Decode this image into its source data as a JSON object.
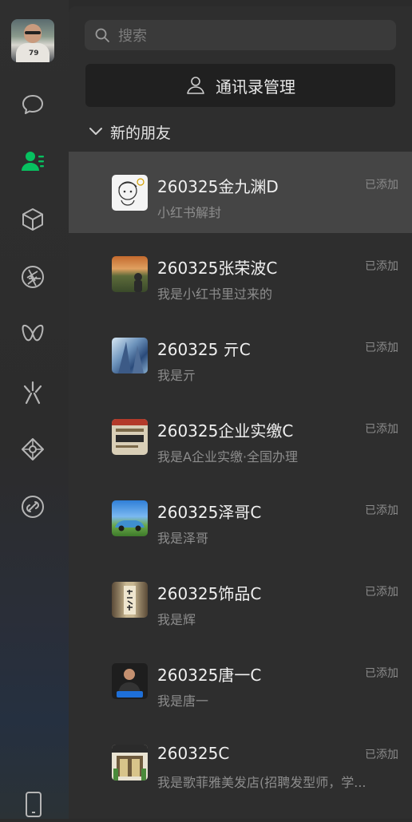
{
  "search": {
    "placeholder": "搜索"
  },
  "manage_button": {
    "label": "通讯录管理"
  },
  "section": {
    "title": "新的朋友"
  },
  "contacts": [
    {
      "name": "260325金九渊D",
      "message": "小红书解封",
      "status": "已添加",
      "avatar_icon": "cartoon-avatar"
    },
    {
      "name": "260325张荣波C",
      "message": "我是小红书里过来的",
      "status": "已添加",
      "avatar_icon": "landscape-avatar"
    },
    {
      "name": "260325 亓C",
      "message": "我是亓",
      "status": "已添加",
      "avatar_icon": "skyscraper-avatar"
    },
    {
      "name": "260325企业实缴C",
      "message": "我是A企业实缴·全国办理",
      "status": "已添加",
      "avatar_icon": "document-avatar"
    },
    {
      "name": "260325泽哥C",
      "message": "我是泽哥",
      "status": "已添加",
      "avatar_icon": "car-avatar"
    },
    {
      "name": "260325饰品C",
      "message": "我是辉",
      "status": "已添加",
      "avatar_icon": "calligraphy-avatar"
    },
    {
      "name": "260325唐一C",
      "message": "我是唐一",
      "status": "已添加",
      "avatar_icon": "portrait-avatar"
    },
    {
      "name": "260325C",
      "message": "我是歌菲雅美发店(招聘发型师，学...",
      "status": "已添加",
      "avatar_icon": "storefront-avatar"
    }
  ],
  "colors": {
    "accent": "#07c160",
    "background": "#2e2e2e",
    "selected": "#454545"
  },
  "nav_icons": [
    "chat-icon",
    "contacts-icon",
    "box-icon",
    "aperture-icon",
    "butterfly-icon",
    "spark-icon",
    "diamond-icon",
    "link-icon",
    "phone-icon"
  ]
}
